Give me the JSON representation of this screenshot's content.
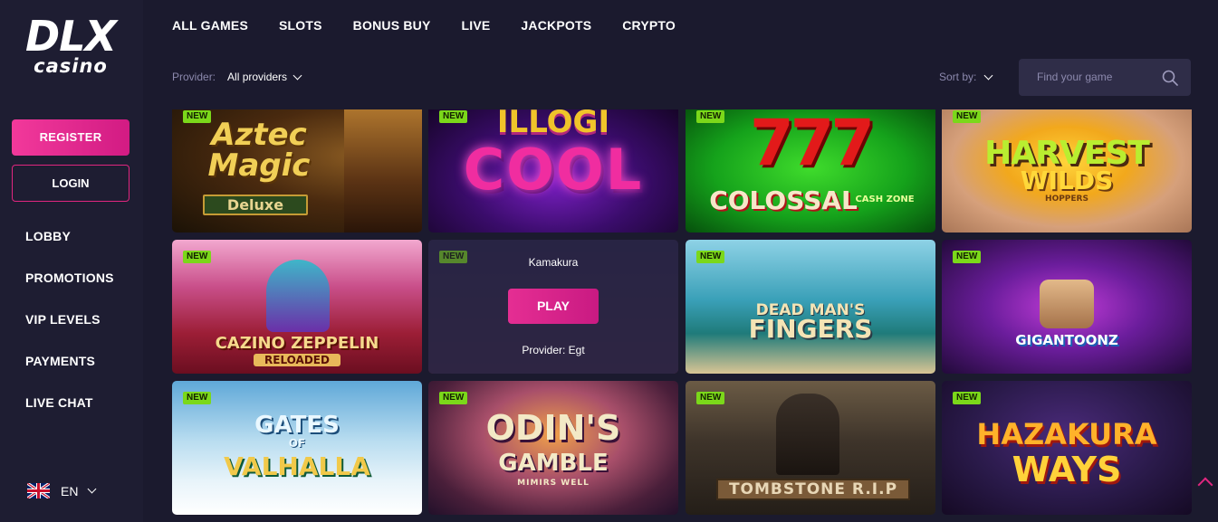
{
  "logo": {
    "line1": "DLX",
    "line2": "casino"
  },
  "sidebar": {
    "register_label": "REGISTER",
    "login_label": "LOGIN",
    "nav": [
      "LOBBY",
      "PROMOTIONS",
      "VIP LEVELS",
      "PAYMENTS",
      "LIVE CHAT"
    ],
    "language": "EN"
  },
  "topnav": [
    "ALL GAMES",
    "SLOTS",
    "BONUS BUY",
    "LIVE",
    "JACKPOTS",
    "CRYPTO"
  ],
  "filters": {
    "provider_label": "Provider:",
    "provider_value": "All providers",
    "sort_label": "Sort by:",
    "search_placeholder": "Find your game"
  },
  "games": [
    {
      "badge": "NEW",
      "title_line1": "Aztec",
      "title_line2": "Magic",
      "title_line3": "Deluxe"
    },
    {
      "badge": "NEW",
      "title_line1": "ILLOGI",
      "title_line2": "COOL",
      "title_line3": ""
    },
    {
      "badge": "NEW",
      "title_line1": "777",
      "title_line2": "COLOSSAL",
      "title_line3": "CASH ZONE"
    },
    {
      "badge": "NEW",
      "title_line1": "HARVEST",
      "title_line2": "WILDS",
      "title_line3": "HOPPERS"
    },
    {
      "badge": "NEW",
      "title_line1": "CAZINO ZEPPELIN",
      "title_line2": "RELOADED",
      "title_line3": ""
    },
    {
      "badge": "NEW",
      "hover_name": "Kamakura",
      "play_label": "PLAY",
      "hover_provider": "Provider: Egt"
    },
    {
      "badge": "NEW",
      "title_line1": "DEAD MAN'S",
      "title_line2": "FINGERS",
      "title_line3": ""
    },
    {
      "badge": "NEW",
      "title_line1": "GIGANTOONZ",
      "title_line2": "",
      "title_line3": ""
    },
    {
      "badge": "NEW",
      "title_line1": "GATES",
      "title_line2": "OF",
      "title_line3": "VALHALLA"
    },
    {
      "badge": "NEW",
      "title_line1": "ODIN'S",
      "title_line2": "GAMBLE",
      "title_line3": "MIMIRS WELL"
    },
    {
      "badge": "NEW",
      "title_line1": "TOMBSTONE R.I.P",
      "title_line2": "",
      "title_line3": ""
    },
    {
      "badge": "NEW",
      "title_line1": "HAZAKURA",
      "title_line2": "WAYS",
      "title_line3": ""
    }
  ],
  "colors": {
    "accent": "#e0267f",
    "badge": "#7bd81a",
    "background": "#1b1a2e"
  }
}
